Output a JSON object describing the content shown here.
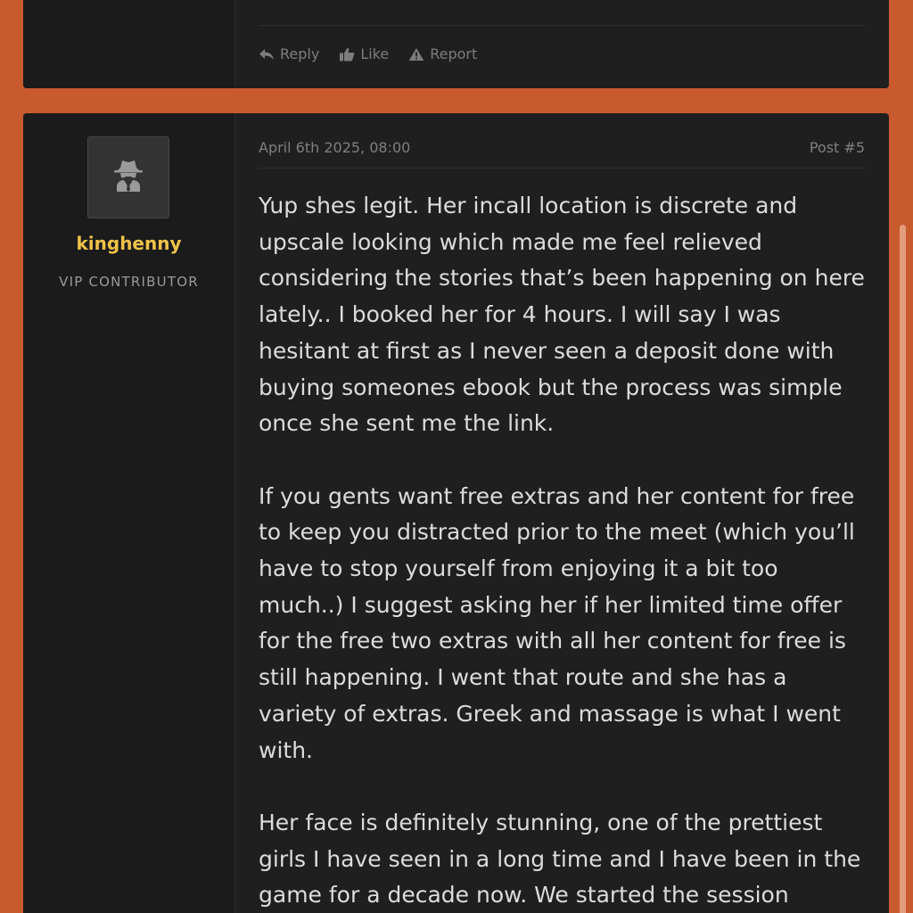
{
  "top_post": {
    "actions": {
      "reply": "Reply",
      "like": "Like",
      "report": "Report"
    }
  },
  "post": {
    "user": {
      "avatar_icon": "spy-icon",
      "username": "kinghenny",
      "title": "VIP CONTRIBUTOR"
    },
    "date": "April 6th 2025, 08:00",
    "number": "Post #5",
    "paragraphs": [
      "Yup shes legit. Her incall location is discrete and upscale looking which made me feel relieved considering the stories that’s been happening on here lately.. I booked her for 4 hours. I will say I was hesitant at first as I never seen a deposit done with buying someones ebook but the process was simple once she sent me the link.",
      "If you gents want free extras and her content for free to keep you distracted prior to the meet (which you’ll have to stop yourself from enjoying it a bit too much..) I suggest asking her if her limited time offer for the free two extras with all her content for free is still happening. I went that route and she has a variety of extras. Greek and massage is what I went with.",
      "Her face is definitely stunning, one of the prettiest girls I have seen in a long time and I have been in the game for a decade now. We started the session"
    ]
  },
  "colors": {
    "background": "#c95a2e",
    "card": "#1f1f1f",
    "username": "#f0c24a",
    "text": "#dcdcdc",
    "muted": "#7f7f7f"
  }
}
